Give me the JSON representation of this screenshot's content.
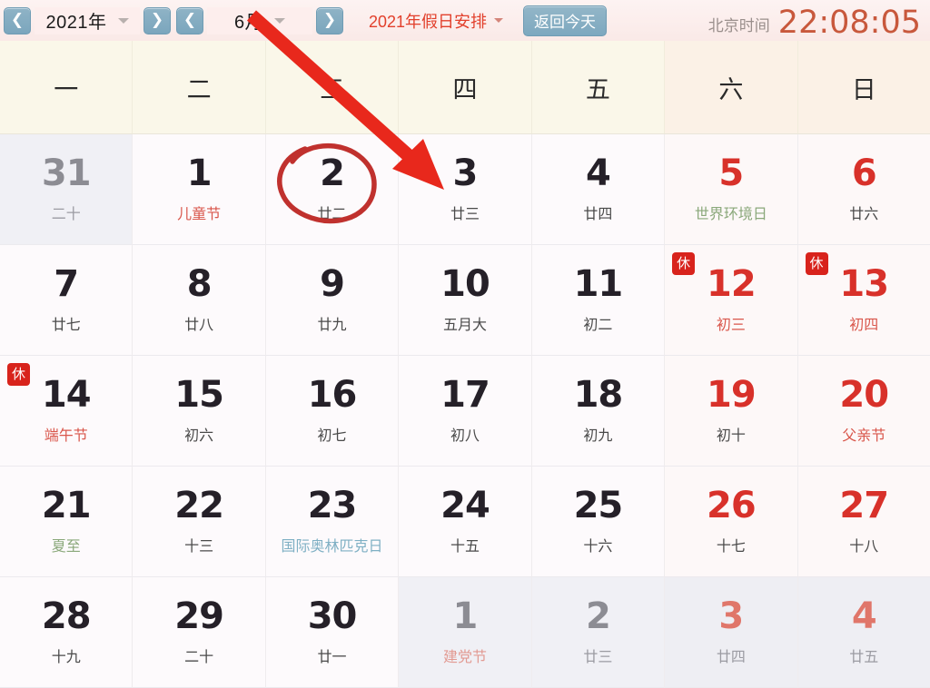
{
  "toolbar": {
    "prev_year_icon": "chevron-left",
    "year_value": "2021年",
    "next_year_icon": "chevron-right",
    "prev_month_icon": "chevron-left",
    "month_value": "6月",
    "next_month_icon": "chevron-right",
    "holiday_label": "2021年假日安排",
    "today_button": "返回今天",
    "clock_label": "北京时间",
    "clock_time": "22:08:05",
    "accent_blue": "#7ba6bd",
    "accent_red": "#e2402c",
    "clock_color": "#c8583c"
  },
  "weekdays": [
    "一",
    "二",
    "三",
    "四",
    "五",
    "六",
    "日"
  ],
  "annotation": {
    "circle_target_day": "2",
    "arrow_color": "#e8281c",
    "circle_color": "#c0312e"
  },
  "weeks": [
    [
      {
        "day": "31",
        "sub": "二十",
        "num_style": "grey",
        "sub_style": "grey",
        "badge": "",
        "out": true,
        "weekend": false
      },
      {
        "day": "1",
        "sub": "儿童节",
        "num_style": "dark",
        "sub_style": "red",
        "badge": "",
        "out": false,
        "weekend": false
      },
      {
        "day": "2",
        "sub": "廿二",
        "num_style": "dark",
        "sub_style": "normal",
        "badge": "",
        "out": false,
        "weekend": false
      },
      {
        "day": "3",
        "sub": "廿三",
        "num_style": "dark",
        "sub_style": "normal",
        "badge": "",
        "out": false,
        "weekend": false
      },
      {
        "day": "4",
        "sub": "廿四",
        "num_style": "dark",
        "sub_style": "normal",
        "badge": "",
        "out": false,
        "weekend": false
      },
      {
        "day": "5",
        "sub": "世界环境日",
        "num_style": "red",
        "sub_style": "green",
        "badge": "",
        "out": false,
        "weekend": true
      },
      {
        "day": "6",
        "sub": "廿六",
        "num_style": "red",
        "sub_style": "normal",
        "badge": "",
        "out": false,
        "weekend": true
      }
    ],
    [
      {
        "day": "7",
        "sub": "廿七",
        "num_style": "dark",
        "sub_style": "normal",
        "badge": "",
        "out": false,
        "weekend": false
      },
      {
        "day": "8",
        "sub": "廿八",
        "num_style": "dark",
        "sub_style": "normal",
        "badge": "",
        "out": false,
        "weekend": false
      },
      {
        "day": "9",
        "sub": "廿九",
        "num_style": "dark",
        "sub_style": "normal",
        "badge": "",
        "out": false,
        "weekend": false
      },
      {
        "day": "10",
        "sub": "五月大",
        "num_style": "dark",
        "sub_style": "normal",
        "badge": "",
        "out": false,
        "weekend": false
      },
      {
        "day": "11",
        "sub": "初二",
        "num_style": "dark",
        "sub_style": "normal",
        "badge": "",
        "out": false,
        "weekend": false
      },
      {
        "day": "12",
        "sub": "初三",
        "num_style": "red",
        "sub_style": "red",
        "badge": "休",
        "out": false,
        "weekend": true
      },
      {
        "day": "13",
        "sub": "初四",
        "num_style": "red",
        "sub_style": "red",
        "badge": "休",
        "out": false,
        "weekend": true
      }
    ],
    [
      {
        "day": "14",
        "sub": "端午节",
        "num_style": "dark",
        "sub_style": "red",
        "badge": "休",
        "out": false,
        "weekend": false
      },
      {
        "day": "15",
        "sub": "初六",
        "num_style": "dark",
        "sub_style": "normal",
        "badge": "",
        "out": false,
        "weekend": false
      },
      {
        "day": "16",
        "sub": "初七",
        "num_style": "dark",
        "sub_style": "normal",
        "badge": "",
        "out": false,
        "weekend": false
      },
      {
        "day": "17",
        "sub": "初八",
        "num_style": "dark",
        "sub_style": "normal",
        "badge": "",
        "out": false,
        "weekend": false
      },
      {
        "day": "18",
        "sub": "初九",
        "num_style": "dark",
        "sub_style": "normal",
        "badge": "",
        "out": false,
        "weekend": false
      },
      {
        "day": "19",
        "sub": "初十",
        "num_style": "red",
        "sub_style": "normal",
        "badge": "",
        "out": false,
        "weekend": true
      },
      {
        "day": "20",
        "sub": "父亲节",
        "num_style": "red",
        "sub_style": "red",
        "badge": "",
        "out": false,
        "weekend": true
      }
    ],
    [
      {
        "day": "21",
        "sub": "夏至",
        "num_style": "dark",
        "sub_style": "green",
        "badge": "",
        "out": false,
        "weekend": false
      },
      {
        "day": "22",
        "sub": "十三",
        "num_style": "dark",
        "sub_style": "normal",
        "badge": "",
        "out": false,
        "weekend": false
      },
      {
        "day": "23",
        "sub": "国际奥林匹克日",
        "num_style": "dark",
        "sub_style": "blue",
        "badge": "",
        "out": false,
        "weekend": false
      },
      {
        "day": "24",
        "sub": "十五",
        "num_style": "dark",
        "sub_style": "normal",
        "badge": "",
        "out": false,
        "weekend": false
      },
      {
        "day": "25",
        "sub": "十六",
        "num_style": "dark",
        "sub_style": "normal",
        "badge": "",
        "out": false,
        "weekend": false
      },
      {
        "day": "26",
        "sub": "十七",
        "num_style": "red",
        "sub_style": "normal",
        "badge": "",
        "out": false,
        "weekend": true
      },
      {
        "day": "27",
        "sub": "十八",
        "num_style": "red",
        "sub_style": "normal",
        "badge": "",
        "out": false,
        "weekend": true
      }
    ],
    [
      {
        "day": "28",
        "sub": "十九",
        "num_style": "dark",
        "sub_style": "normal",
        "badge": "",
        "out": false,
        "weekend": false
      },
      {
        "day": "29",
        "sub": "二十",
        "num_style": "dark",
        "sub_style": "normal",
        "badge": "",
        "out": false,
        "weekend": false
      },
      {
        "day": "30",
        "sub": "廿一",
        "num_style": "dark",
        "sub_style": "normal",
        "badge": "",
        "out": false,
        "weekend": false
      },
      {
        "day": "1",
        "sub": "建党节",
        "num_style": "grey",
        "sub_style": "pink",
        "badge": "",
        "out": true,
        "weekend": false
      },
      {
        "day": "2",
        "sub": "廿三",
        "num_style": "grey",
        "sub_style": "grey",
        "badge": "",
        "out": true,
        "weekend": false
      },
      {
        "day": "3",
        "sub": "廿四",
        "num_style": "greyred",
        "sub_style": "grey",
        "badge": "",
        "out": true,
        "weekend": true
      },
      {
        "day": "4",
        "sub": "廿五",
        "num_style": "greyred",
        "sub_style": "grey",
        "badge": "",
        "out": true,
        "weekend": true
      }
    ]
  ]
}
